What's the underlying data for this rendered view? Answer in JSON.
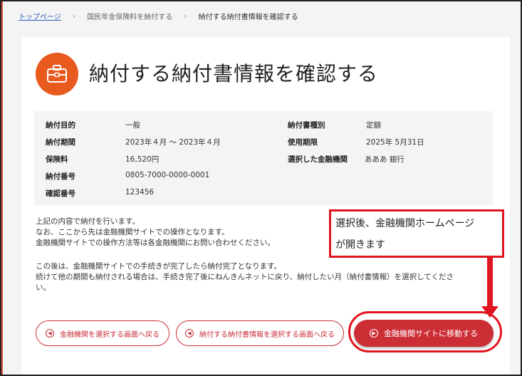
{
  "breadcrumb": {
    "home": "トップページ",
    "middle": "国民年金保険料を納付する",
    "current": "納付する納付書情報を確認する",
    "separator": "›"
  },
  "page": {
    "title": "納付する納付書情報を確認する",
    "icon": "briefcase-icon"
  },
  "details": {
    "left": [
      {
        "label": "納付目的",
        "value": "一般"
      },
      {
        "label": "納付期間",
        "value": "2023年４月 ～ 2023年４月"
      },
      {
        "label": "保険料",
        "value": "16,520円"
      },
      {
        "label": "納付番号",
        "value": "0805-7000-0000-0001"
      },
      {
        "label": "確認番号",
        "value": "123456"
      }
    ],
    "right": [
      {
        "label": "納付書種別",
        "value": "定額"
      },
      {
        "label": "使用期限",
        "value": "2025年 5月31日"
      },
      {
        "label": "選択した金融機関",
        "value": "あああ 銀行"
      }
    ]
  },
  "messages": {
    "line1": "上記の内容で納付を行います。",
    "line2": "なお、ここから先は金融機関サイトでの操作となります。",
    "line3": "金融機関サイトでの操作方法等は各金融機関にお問い合わせください。",
    "line4": "この後は、金融機関サイトでの手続きが完了したら納付完了となります。",
    "line5": "続けて他の期間も納付される場合は、手続き完了後にねんきんネットに戻り、納付したい月（納付書情報）を選択してくださ",
    "line6": "い。"
  },
  "callout": {
    "line1": "選択後、金融機関ホームページ",
    "line2": "が開きます"
  },
  "buttons": {
    "back_bank": "金融機関を選択する画面へ戻る",
    "back_info": "納付する納付書情報を選択する画面へ戻る",
    "go_bank": "金融機関サイトに移動する"
  },
  "colors": {
    "accent": "#e85a1e",
    "primary_button": "#cc2e36",
    "annotation": "#e0141e",
    "link": "#2a5bb7"
  }
}
